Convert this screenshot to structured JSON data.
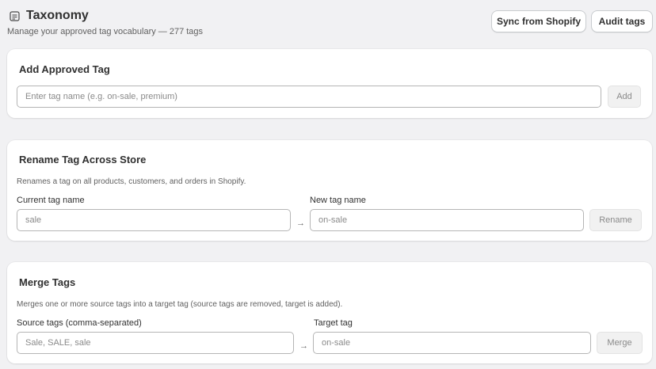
{
  "header": {
    "title": "Taxonomy",
    "subtitle": "Manage your approved tag vocabulary — 277 tags",
    "icon": "list-box-icon",
    "sync_label": "Sync from Shopify",
    "audit_label": "Audit tags"
  },
  "add_card": {
    "title": "Add Approved Tag",
    "input_placeholder": "Enter tag name (e.g. on-sale, premium)",
    "button_label": "Add"
  },
  "rename_card": {
    "title": "Rename Tag Across Store",
    "description": "Renames a tag on all products, customers, and orders in Shopify.",
    "current_label": "Current tag name",
    "current_placeholder": "sale",
    "new_label": "New tag name",
    "new_placeholder": "on-sale",
    "arrow": "→",
    "button_label": "Rename"
  },
  "merge_card": {
    "title": "Merge Tags",
    "description": "Merges one or more source tags into a target tag (source tags are removed, target is added).",
    "source_label": "Source tags (comma-separated)",
    "source_placeholder": "Sale, SALE, sale",
    "target_label": "Target tag",
    "target_placeholder": "on-sale",
    "arrow": "→",
    "button_label": "Merge"
  }
}
